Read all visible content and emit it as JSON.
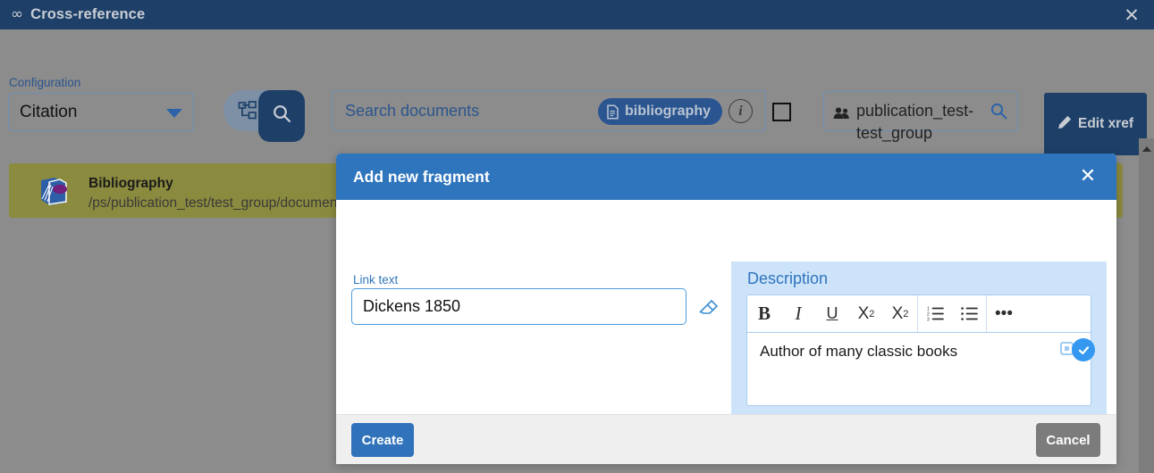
{
  "window": {
    "title": "Cross-reference",
    "title_icon": "infinity-icon",
    "close_label": "✕"
  },
  "toolbar": {
    "configuration_label": "Configuration",
    "configuration_value": "Citation",
    "configuration_caret_icon": "chevron-down-icon",
    "tree_mode_icon": "sitemap-icon",
    "search_mode_icon": "search-icon",
    "search": {
      "placeholder": "Search documents",
      "chip_label": "bibliography",
      "chip_icon": "document-icon",
      "info_icon": "i"
    },
    "select_all_checkbox": "",
    "group": {
      "icon": "users-icon",
      "value": "publication_test-test_group",
      "search_icon": "search-icon"
    },
    "edit_xref_label": "Edit xref",
    "edit_xref_icon": "pencil-icon"
  },
  "results": [
    {
      "icon": "document-stack-icon",
      "title": "Bibliography",
      "path": "/ps/publication_test/test_group/documents/b"
    }
  ],
  "scrollbar": {
    "up_arrow_icon": "caret-up-icon"
  },
  "modal": {
    "title": "Add new fragment",
    "close_label": "✕",
    "link_text": {
      "label": "Link text",
      "value": "Dickens 1850",
      "placeholder": "",
      "clear_icon": "eraser-icon"
    },
    "description": {
      "label": "Description",
      "content": "Author of many classic books",
      "toolbar": [
        {
          "name": "bold-button",
          "label": "B"
        },
        {
          "name": "italic-button",
          "label": "I"
        },
        {
          "name": "underline-button",
          "label": "U"
        },
        {
          "name": "superscript-button",
          "label": "X"
        },
        {
          "name": "subscript-button",
          "label": "X"
        },
        {
          "name": "ordered-list-button",
          "label": ""
        },
        {
          "name": "unordered-list-button",
          "label": ""
        },
        {
          "name": "more-options-button",
          "label": "•••"
        }
      ]
    },
    "create_label": "Create",
    "cancel_label": "Cancel"
  },
  "colors": {
    "header_navy": "#1d3f68",
    "modal_blue": "#2f75bd",
    "result_olive": "#8b8b3f",
    "page_gray": "#8c8c8c",
    "desc_panel_blue": "#cde3fa",
    "create_blue": "#3073bb",
    "cancel_gray": "#7c7c7c"
  }
}
